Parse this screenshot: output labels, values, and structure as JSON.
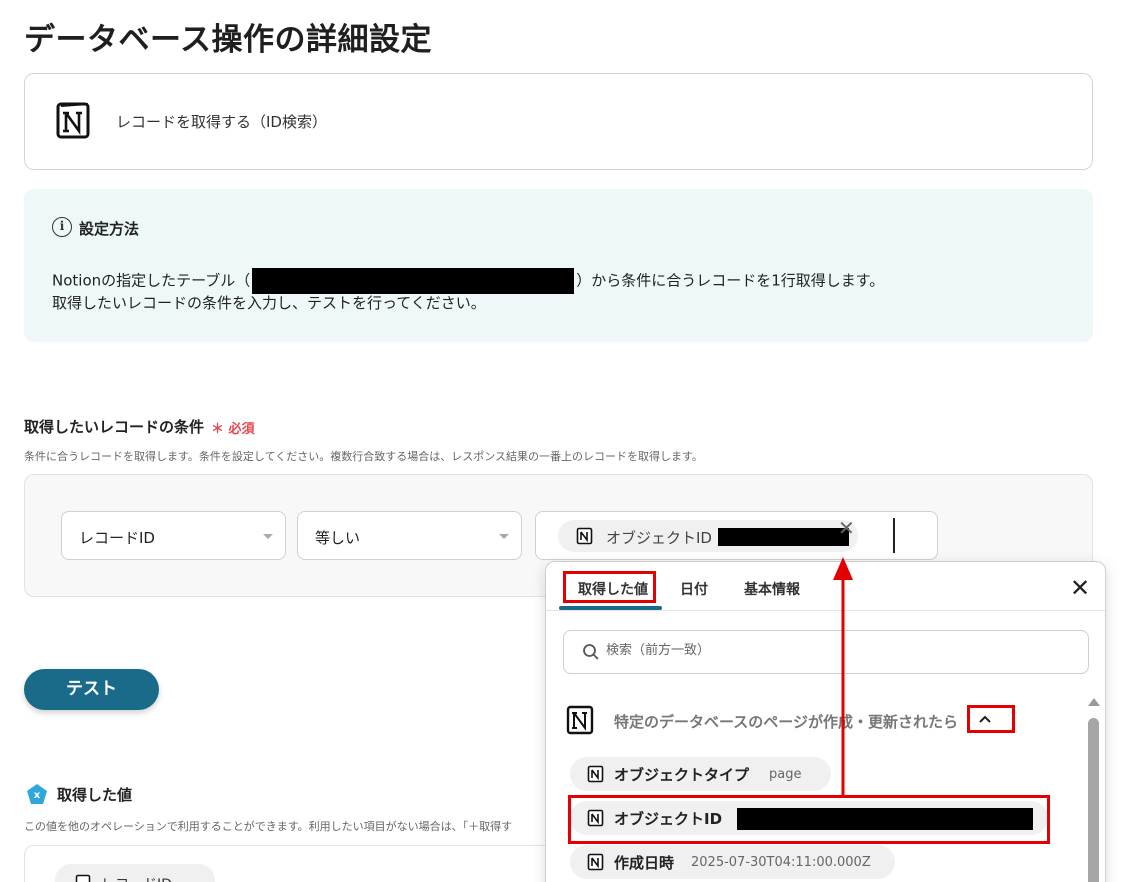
{
  "page": {
    "title": "データベース操作の詳細設定"
  },
  "app_card": {
    "label": "レコードを取得する（ID検索）",
    "icon": "notion-logo-icon"
  },
  "info": {
    "title": "設定方法",
    "line1_prefix": "Notionの指定したテーブル（",
    "line1_suffix": "）から条件に合うレコードを1行取得します。",
    "line2": "取得したいレコードの条件を入力し、テストを行ってください。"
  },
  "condition": {
    "label": "取得したいレコードの条件",
    "required": "＊ 必須",
    "description": "条件に合うレコードを取得します。条件を設定してください。複数行合致する場合は、レスポンス結果の一番上のレコードを取得します。",
    "field_select": "レコードID",
    "operator_select": "等しい",
    "value_chip": "オブジェクトID"
  },
  "test_button": "テスト",
  "obtained": {
    "label": "取得した値",
    "description": "この値を他のオペレーションで利用することができます。利用したい項目がない場合は、「＋取得す",
    "first_chip": "レコードID"
  },
  "popup": {
    "tabs": [
      "取得した値",
      "日付",
      "基本情報"
    ],
    "search_placeholder": "検索（前方一致）",
    "section_label": "特定のデータベースのページが作成・更新されたら",
    "items": [
      {
        "label": "オブジェクトタイプ",
        "value": "page"
      },
      {
        "label": "オブジェクトID",
        "value": ""
      },
      {
        "label": "作成日時",
        "value": "2025-07-30T04:11:00.000Z"
      }
    ]
  },
  "colors": {
    "accent": "#1a6b8a",
    "highlight": "#e40000",
    "required": "#e5484d",
    "info_bg": "#eff8f8"
  }
}
